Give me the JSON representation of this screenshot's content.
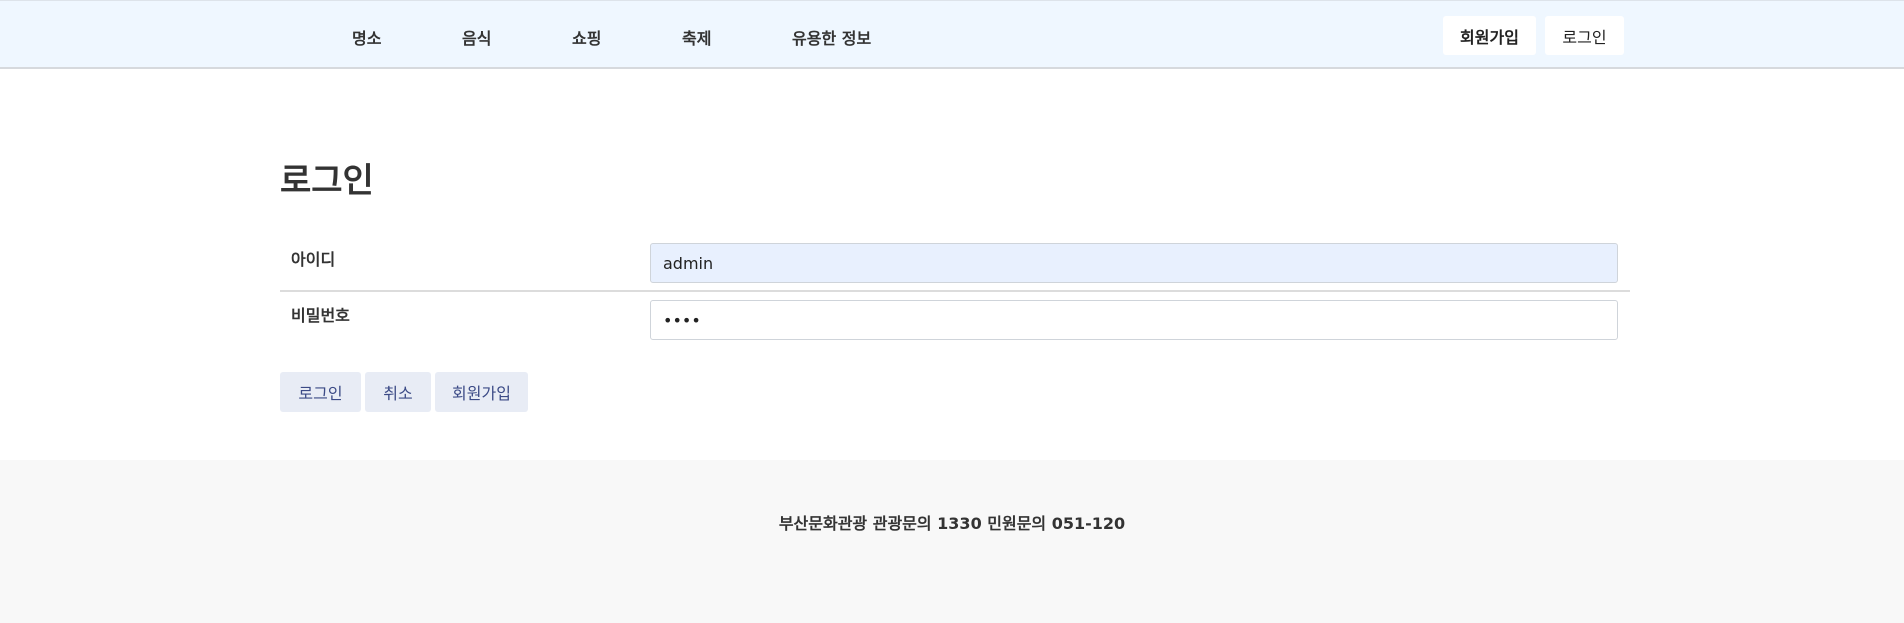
{
  "header": {
    "nav": [
      "명소",
      "음식",
      "쇼핑",
      "축제",
      "유용한 정보"
    ],
    "signup_label": "회원가입",
    "login_label": "로그인"
  },
  "main": {
    "title": "로그인",
    "fields": [
      {
        "label": "아이디",
        "value": "admin"
      },
      {
        "label": "비밀번호",
        "value": "••••"
      }
    ],
    "buttons": {
      "login": "로그인",
      "cancel": "취소",
      "signup": "회원가입"
    }
  },
  "footer": {
    "text": "부산문화관광 관광문의 1330 민원문의 051-120"
  }
}
